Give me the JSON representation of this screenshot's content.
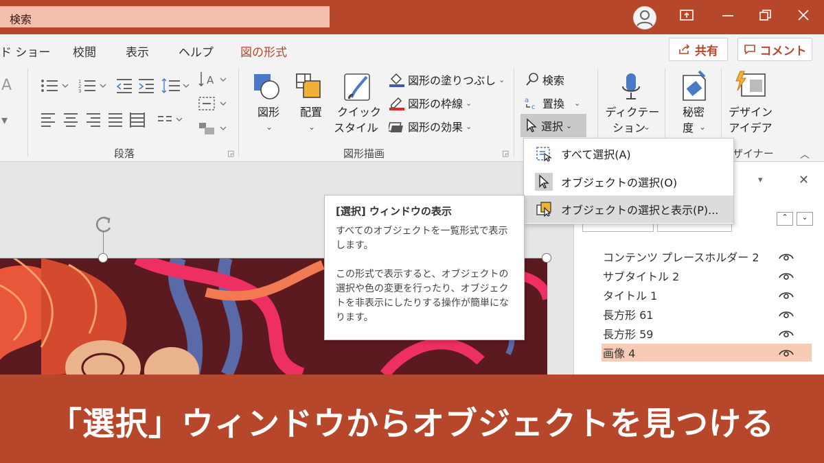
{
  "colors": {
    "accent": "#b7472a",
    "search_bg": "#f4c0ad",
    "selected_item": "#f8cbb5"
  },
  "titlebar": {
    "search_label": "検索",
    "icons": [
      "user-avatar-icon",
      "ribbon-display-icon",
      "minimize-icon",
      "restore-icon",
      "close-icon"
    ]
  },
  "tabs": [
    {
      "label": "ド ショー"
    },
    {
      "label": "校閲"
    },
    {
      "label": "表示"
    },
    {
      "label": "ヘルプ"
    },
    {
      "label": "図の形式",
      "active": true
    }
  ],
  "header_buttons": {
    "share": "共有",
    "comment": "コメント"
  },
  "ribbon": {
    "paragraph_group": "段落",
    "drawing_group": "図形描画",
    "designer_group": "ザイナー",
    "shape_label": "図形",
    "arrange_label": "配置",
    "quick_style_line1": "クイック",
    "quick_style_line2": "スタイル",
    "fill_label": "図形の塗りつぶし",
    "outline_label": "図形の枠線",
    "effects_label": "図形の効果",
    "find_label": "検索",
    "replace_label": "置換",
    "select_label": "選択",
    "dictate_line1": "ディクテー",
    "dictate_line2": "ション",
    "sensitivity_line1": "秘密",
    "sensitivity_line2": "度",
    "design_line1": "デザイン",
    "design_line2": "アイデア"
  },
  "dropdown": {
    "items": [
      {
        "label": "すべて選択(A)"
      },
      {
        "label": "オブジェクトの選択(O)"
      },
      {
        "label": "オブジェクトの選択と表示(P)...",
        "highlighted": true
      }
    ]
  },
  "tooltip": {
    "title": "[選択] ウィンドウの表示",
    "para1": "すべてのオブジェクトを一覧形式で表示します。",
    "para2": "この形式で表示すると、オブジェクトの選択や色の変更を行ったり、オブジェクトを非表示にしたりする操作が簡単になります。"
  },
  "selection_pane": {
    "items": [
      {
        "name": "コンテンツ プレースホルダー 2"
      },
      {
        "name": "サブタイトル 2"
      },
      {
        "name": "タイトル 1"
      },
      {
        "name": "長方形 61"
      },
      {
        "name": "長方形 59"
      },
      {
        "name": "画像 4",
        "selected": true
      }
    ]
  },
  "banner": {
    "text": "「選択」ウィンドウからオブジェクトを見つける"
  }
}
